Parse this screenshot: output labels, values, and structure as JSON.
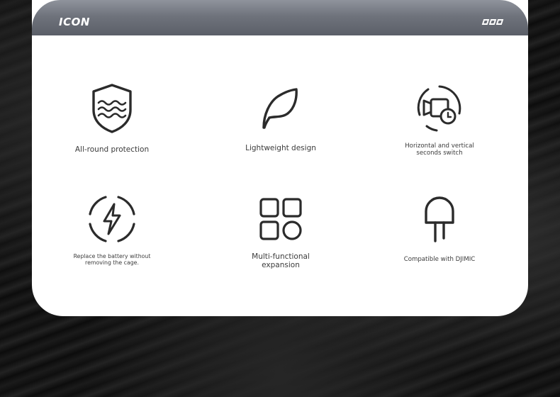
{
  "header": {
    "title": "ICON"
  },
  "features": [
    {
      "label": "All-round protection",
      "icon": "shield-waves-icon"
    },
    {
      "label": "Lightweight design",
      "icon": "feather-icon"
    },
    {
      "label_line1": "Horizontal and vertical",
      "label_line2": "seconds switch",
      "icon": "camera-rotate-icon"
    },
    {
      "label_line1": "Replace the battery without",
      "label_line2": "removing the cage.",
      "icon": "lightning-icon"
    },
    {
      "label_line1": "Multi-functional",
      "label_line2": "expansion",
      "icon": "grid-expansion-icon"
    },
    {
      "label": "Compatible with DJIMIC",
      "icon": "microphone-icon"
    }
  ]
}
